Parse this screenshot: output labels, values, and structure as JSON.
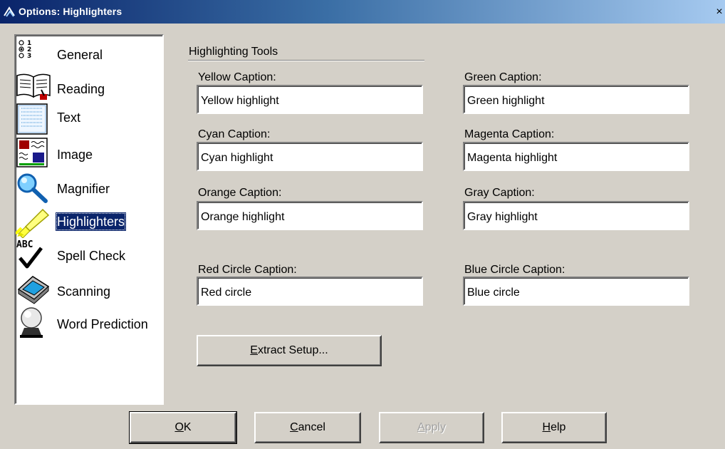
{
  "window": {
    "title": "Options: Highlighters",
    "close_glyph": "×"
  },
  "sidebar": {
    "items": [
      {
        "label": "General",
        "icon": "numbered-options-icon"
      },
      {
        "label": "Reading",
        "icon": "book-icon"
      },
      {
        "label": "Text",
        "icon": "text-page-icon"
      },
      {
        "label": "Image",
        "icon": "image-icon"
      },
      {
        "label": "Magnifier",
        "icon": "magnifier-icon"
      },
      {
        "label": "Highlighters",
        "icon": "highlighter-icon",
        "selected": true
      },
      {
        "label": "Spell Check",
        "icon": "spell-check-icon"
      },
      {
        "label": "Scanning",
        "icon": "scanner-icon"
      },
      {
        "label": "Word Prediction",
        "icon": "crystal-ball-icon"
      }
    ]
  },
  "panel": {
    "group_title": "Highlighting Tools",
    "fields": {
      "yellow": {
        "label": "Yellow Caption:",
        "value": "Yellow highlight"
      },
      "green": {
        "label": "Green Caption:",
        "value": "Green highlight"
      },
      "cyan": {
        "label": "Cyan Caption:",
        "value": "Cyan highlight"
      },
      "magenta": {
        "label": "Magenta Caption:",
        "value": "Magenta highlight"
      },
      "orange": {
        "label": "Orange Caption:",
        "value": "Orange highlight"
      },
      "gray": {
        "label": "Gray Caption:",
        "value": "Gray highlight"
      },
      "red_circle": {
        "label": "Red Circle Caption:",
        "value": "Red circle"
      },
      "blue_circle": {
        "label": "Blue Circle Caption:",
        "value": "Blue circle"
      }
    },
    "extract_button": {
      "mnemonic": "E",
      "rest": "xtract Setup..."
    }
  },
  "buttons": {
    "ok": {
      "mnemonic": "O",
      "rest": "K"
    },
    "cancel": {
      "mnemonic": "C",
      "rest": "ancel"
    },
    "apply": {
      "mnemonic": "A",
      "rest": "pply",
      "disabled": true
    },
    "help": {
      "mnemonic": "H",
      "rest": "elp"
    }
  },
  "colors": {
    "selection": "#0a246a",
    "face": "#d4d0c8",
    "titlebar_start": "#0a246a",
    "titlebar_end": "#a6caf0"
  }
}
